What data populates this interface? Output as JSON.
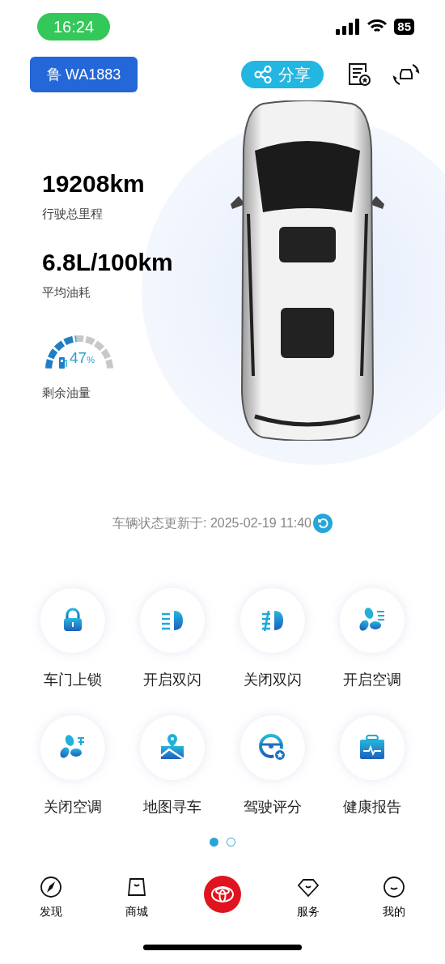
{
  "status_bar": {
    "time": "16:24",
    "battery": "85"
  },
  "header": {
    "plate": "鲁 WA1883",
    "share": "分享"
  },
  "stats": [
    {
      "value": "19208km",
      "label": "行驶总里程"
    },
    {
      "value": "6.8L/100km",
      "label": "平均油耗"
    }
  ],
  "fuel": {
    "level": 0.47,
    "reading": "47",
    "unit": "%",
    "label": "剩余油量"
  },
  "update": {
    "text": "车辆状态更新于: 2025-02-19 11:40"
  },
  "actions": [
    {
      "kind": "lock",
      "label": "车门上锁"
    },
    {
      "kind": "lights_on",
      "label": "开启双闪"
    },
    {
      "kind": "lights_off",
      "label": "关闭双闪"
    },
    {
      "kind": "ac_on",
      "label": "开启空调"
    },
    {
      "kind": "ac_off",
      "label": "关闭空调"
    },
    {
      "kind": "map",
      "label": "地图寻车"
    },
    {
      "kind": "wheel",
      "label": "驾驶评分"
    },
    {
      "kind": "health",
      "label": "健康报告"
    }
  ],
  "pages": [
    {
      "selected": true
    },
    {
      "selected": false
    }
  ],
  "nav": [
    {
      "kind": "compass",
      "label": "发现"
    },
    {
      "kind": "bag",
      "label": "商城"
    },
    {
      "kind": "logo"
    },
    {
      "kind": "diamond",
      "label": "服务"
    },
    {
      "kind": "smile",
      "label": "我的"
    }
  ]
}
